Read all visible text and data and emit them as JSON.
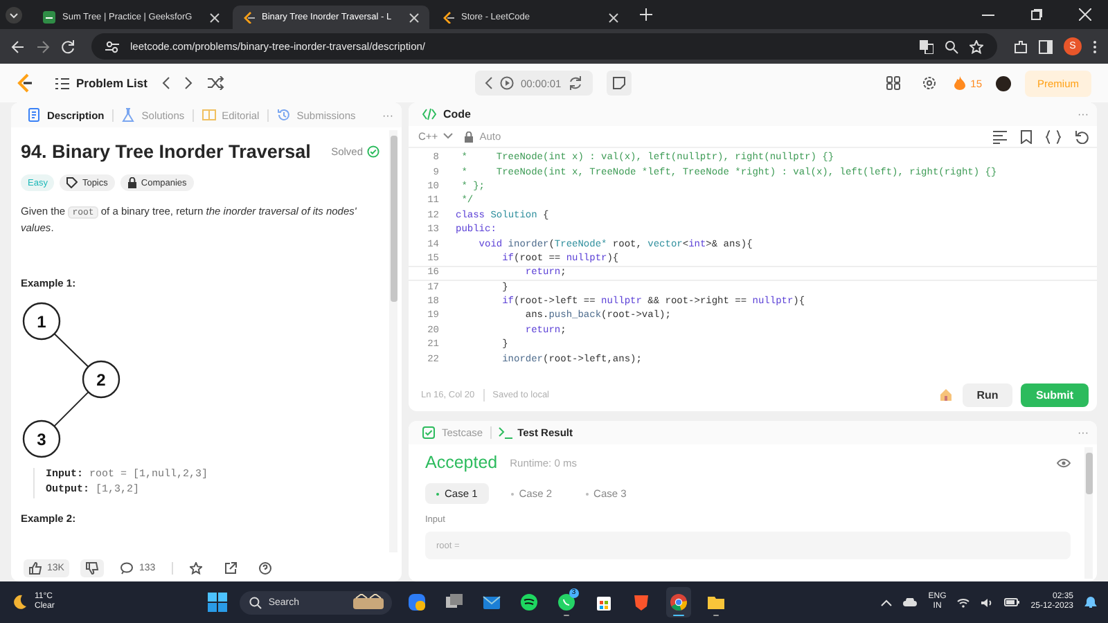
{
  "browser": {
    "tabs": [
      {
        "title": "Sum Tree | Practice | GeeksforG",
        "selected": false
      },
      {
        "title": "Binary Tree Inorder Traversal - L",
        "selected": true
      },
      {
        "title": "Store - LeetCode",
        "selected": false
      }
    ],
    "url": "leetcode.com/problems/binary-tree-inorder-traversal/description/",
    "profile_initial": "S"
  },
  "nav": {
    "problem_list": "Problem List",
    "timer": "00:00:01",
    "streak": "15",
    "premium": "Premium"
  },
  "left_panel": {
    "tabs": [
      {
        "label": "Description",
        "selected": true
      },
      {
        "label": "Solutions",
        "selected": false
      },
      {
        "label": "Editorial",
        "selected": false
      },
      {
        "label": "Submissions",
        "selected": false
      }
    ],
    "more": "···",
    "title": "94. Binary Tree Inorder Traversal",
    "status": "Solved",
    "tags": [
      {
        "label": "Easy",
        "kind": "difficulty"
      },
      {
        "label": "Topics",
        "kind": "topics"
      },
      {
        "label": "Companies",
        "kind": "companies"
      }
    ],
    "description": [
      {
        "kind": "text",
        "text": "Given the "
      },
      {
        "kind": "code",
        "text": "root"
      },
      {
        "kind": "text",
        "text": " of a binary tree, return *the inorder traversal of its nodes' values*."
      }
    ],
    "example_1": {
      "heading": "Example 1:",
      "tree": {
        "nodes": [
          "1",
          "2",
          "3"
        ]
      },
      "lines": [
        "**Input:** root = [1,null,2,3]",
        "**Output:** [1,3,2]"
      ]
    },
    "example_2": {
      "heading": "Example 2:"
    },
    "footer": {
      "likes": "13K",
      "comments": "133"
    }
  },
  "code_panel": {
    "title": "Code",
    "more": "···",
    "language": "C++",
    "mode": "Auto",
    "lines": [
      {
        "number": "8",
        "current": false,
        "tokens": [
          {
            "kind": "comment",
            "text": " *     TreeNode(int x) : val(x), left(nullptr), right(nullptr) {}"
          }
        ]
      },
      {
        "number": "9",
        "current": false,
        "tokens": [
          {
            "kind": "comment",
            "text": " *     TreeNode(int x, TreeNode *left, TreeNode *right) : val(x), left(left), right(right) {}"
          }
        ]
      },
      {
        "number": "10",
        "current": false,
        "tokens": [
          {
            "kind": "comment",
            "text": " * };"
          }
        ]
      },
      {
        "number": "11",
        "current": false,
        "tokens": [
          {
            "kind": "comment",
            "text": " */"
          }
        ]
      },
      {
        "number": "12",
        "current": false,
        "tokens": [
          {
            "kind": "keyword",
            "text": "class"
          },
          {
            "kind": "type",
            "text": " Solution"
          },
          {
            "kind": "plain",
            "text": " {"
          }
        ]
      },
      {
        "number": "13",
        "current": false,
        "tokens": [
          {
            "kind": "keyword",
            "text": "public:"
          }
        ]
      },
      {
        "number": "14",
        "current": false,
        "tokens": [
          {
            "kind": "keyword",
            "text": "    void"
          },
          {
            "kind": "function",
            "text": " inorder"
          },
          {
            "kind": "plain",
            "text": "("
          },
          {
            "kind": "type",
            "text": "TreeNode*"
          },
          {
            "kind": "plain",
            "text": " root, "
          },
          {
            "kind": "type",
            "text": "vector"
          },
          {
            "kind": "plain",
            "text": "<"
          },
          {
            "kind": "keyword",
            "text": "int"
          },
          {
            "kind": "plain",
            "text": ">& ans){"
          }
        ]
      },
      {
        "number": "15",
        "current": false,
        "tokens": [
          {
            "kind": "keyword",
            "text": "        if"
          },
          {
            "kind": "plain",
            "text": "(root == "
          },
          {
            "kind": "keyword",
            "text": "nullptr"
          },
          {
            "kind": "plain",
            "text": "){"
          }
        ]
      },
      {
        "number": "16",
        "current": true,
        "tokens": [
          {
            "kind": "keyword",
            "text": "            return"
          },
          {
            "kind": "plain",
            "text": ";"
          }
        ]
      },
      {
        "number": "17",
        "current": false,
        "tokens": [
          {
            "kind": "plain",
            "text": "        }"
          }
        ]
      },
      {
        "number": "18",
        "current": false,
        "tokens": [
          {
            "kind": "keyword",
            "text": "        if"
          },
          {
            "kind": "plain",
            "text": "(root->left == "
          },
          {
            "kind": "keyword",
            "text": "nullptr"
          },
          {
            "kind": "plain",
            "text": " && root->right == "
          },
          {
            "kind": "keyword",
            "text": "nullptr"
          },
          {
            "kind": "plain",
            "text": "){"
          }
        ]
      },
      {
        "number": "19",
        "current": false,
        "tokens": [
          {
            "kind": "plain",
            "text": "            ans."
          },
          {
            "kind": "function",
            "text": "push_back"
          },
          {
            "kind": "plain",
            "text": "(root->val);"
          }
        ]
      },
      {
        "number": "20",
        "current": false,
        "tokens": [
          {
            "kind": "keyword",
            "text": "            return"
          },
          {
            "kind": "plain",
            "text": ";"
          }
        ]
      },
      {
        "number": "21",
        "current": false,
        "tokens": [
          {
            "kind": "plain",
            "text": "        }"
          }
        ]
      },
      {
        "number": "22",
        "current": false,
        "tokens": [
          {
            "kind": "function",
            "text": "        inorder"
          },
          {
            "kind": "plain",
            "text": "(root->left,ans);"
          }
        ]
      }
    ],
    "position": "Ln 16, Col 20",
    "save_status": "Saved to local",
    "run": "Run",
    "submit": "Submit"
  },
  "test_panel": {
    "tabs": [
      {
        "label": "Testcase",
        "selected": false
      },
      {
        "label": "Test Result",
        "selected": true
      }
    ],
    "more": "···",
    "verdict": "Accepted",
    "runtime": "Runtime: 0 ms",
    "cases": [
      {
        "label": "Case 1",
        "selected": true
      },
      {
        "label": "Case 2",
        "selected": false
      },
      {
        "label": "Case 3",
        "selected": false
      }
    ],
    "input_label": "Input",
    "input_value": "root ="
  },
  "taskbar": {
    "temperature": "11°C",
    "weather": "Clear",
    "search_placeholder": "Search",
    "apps": [
      {
        "open": false,
        "active": false
      },
      {
        "open": false,
        "active": false
      },
      {
        "open": false,
        "active": false
      },
      {
        "open": false,
        "active": false
      },
      {
        "open": true,
        "active": false,
        "badge": "3"
      },
      {
        "open": false,
        "active": false
      },
      {
        "open": false,
        "active": false
      },
      {
        "open": true,
        "active": true
      },
      {
        "open": true,
        "active": false
      }
    ],
    "language": "ENG",
    "region": "IN",
    "time": "02:35",
    "date": "25-12-2023"
  }
}
